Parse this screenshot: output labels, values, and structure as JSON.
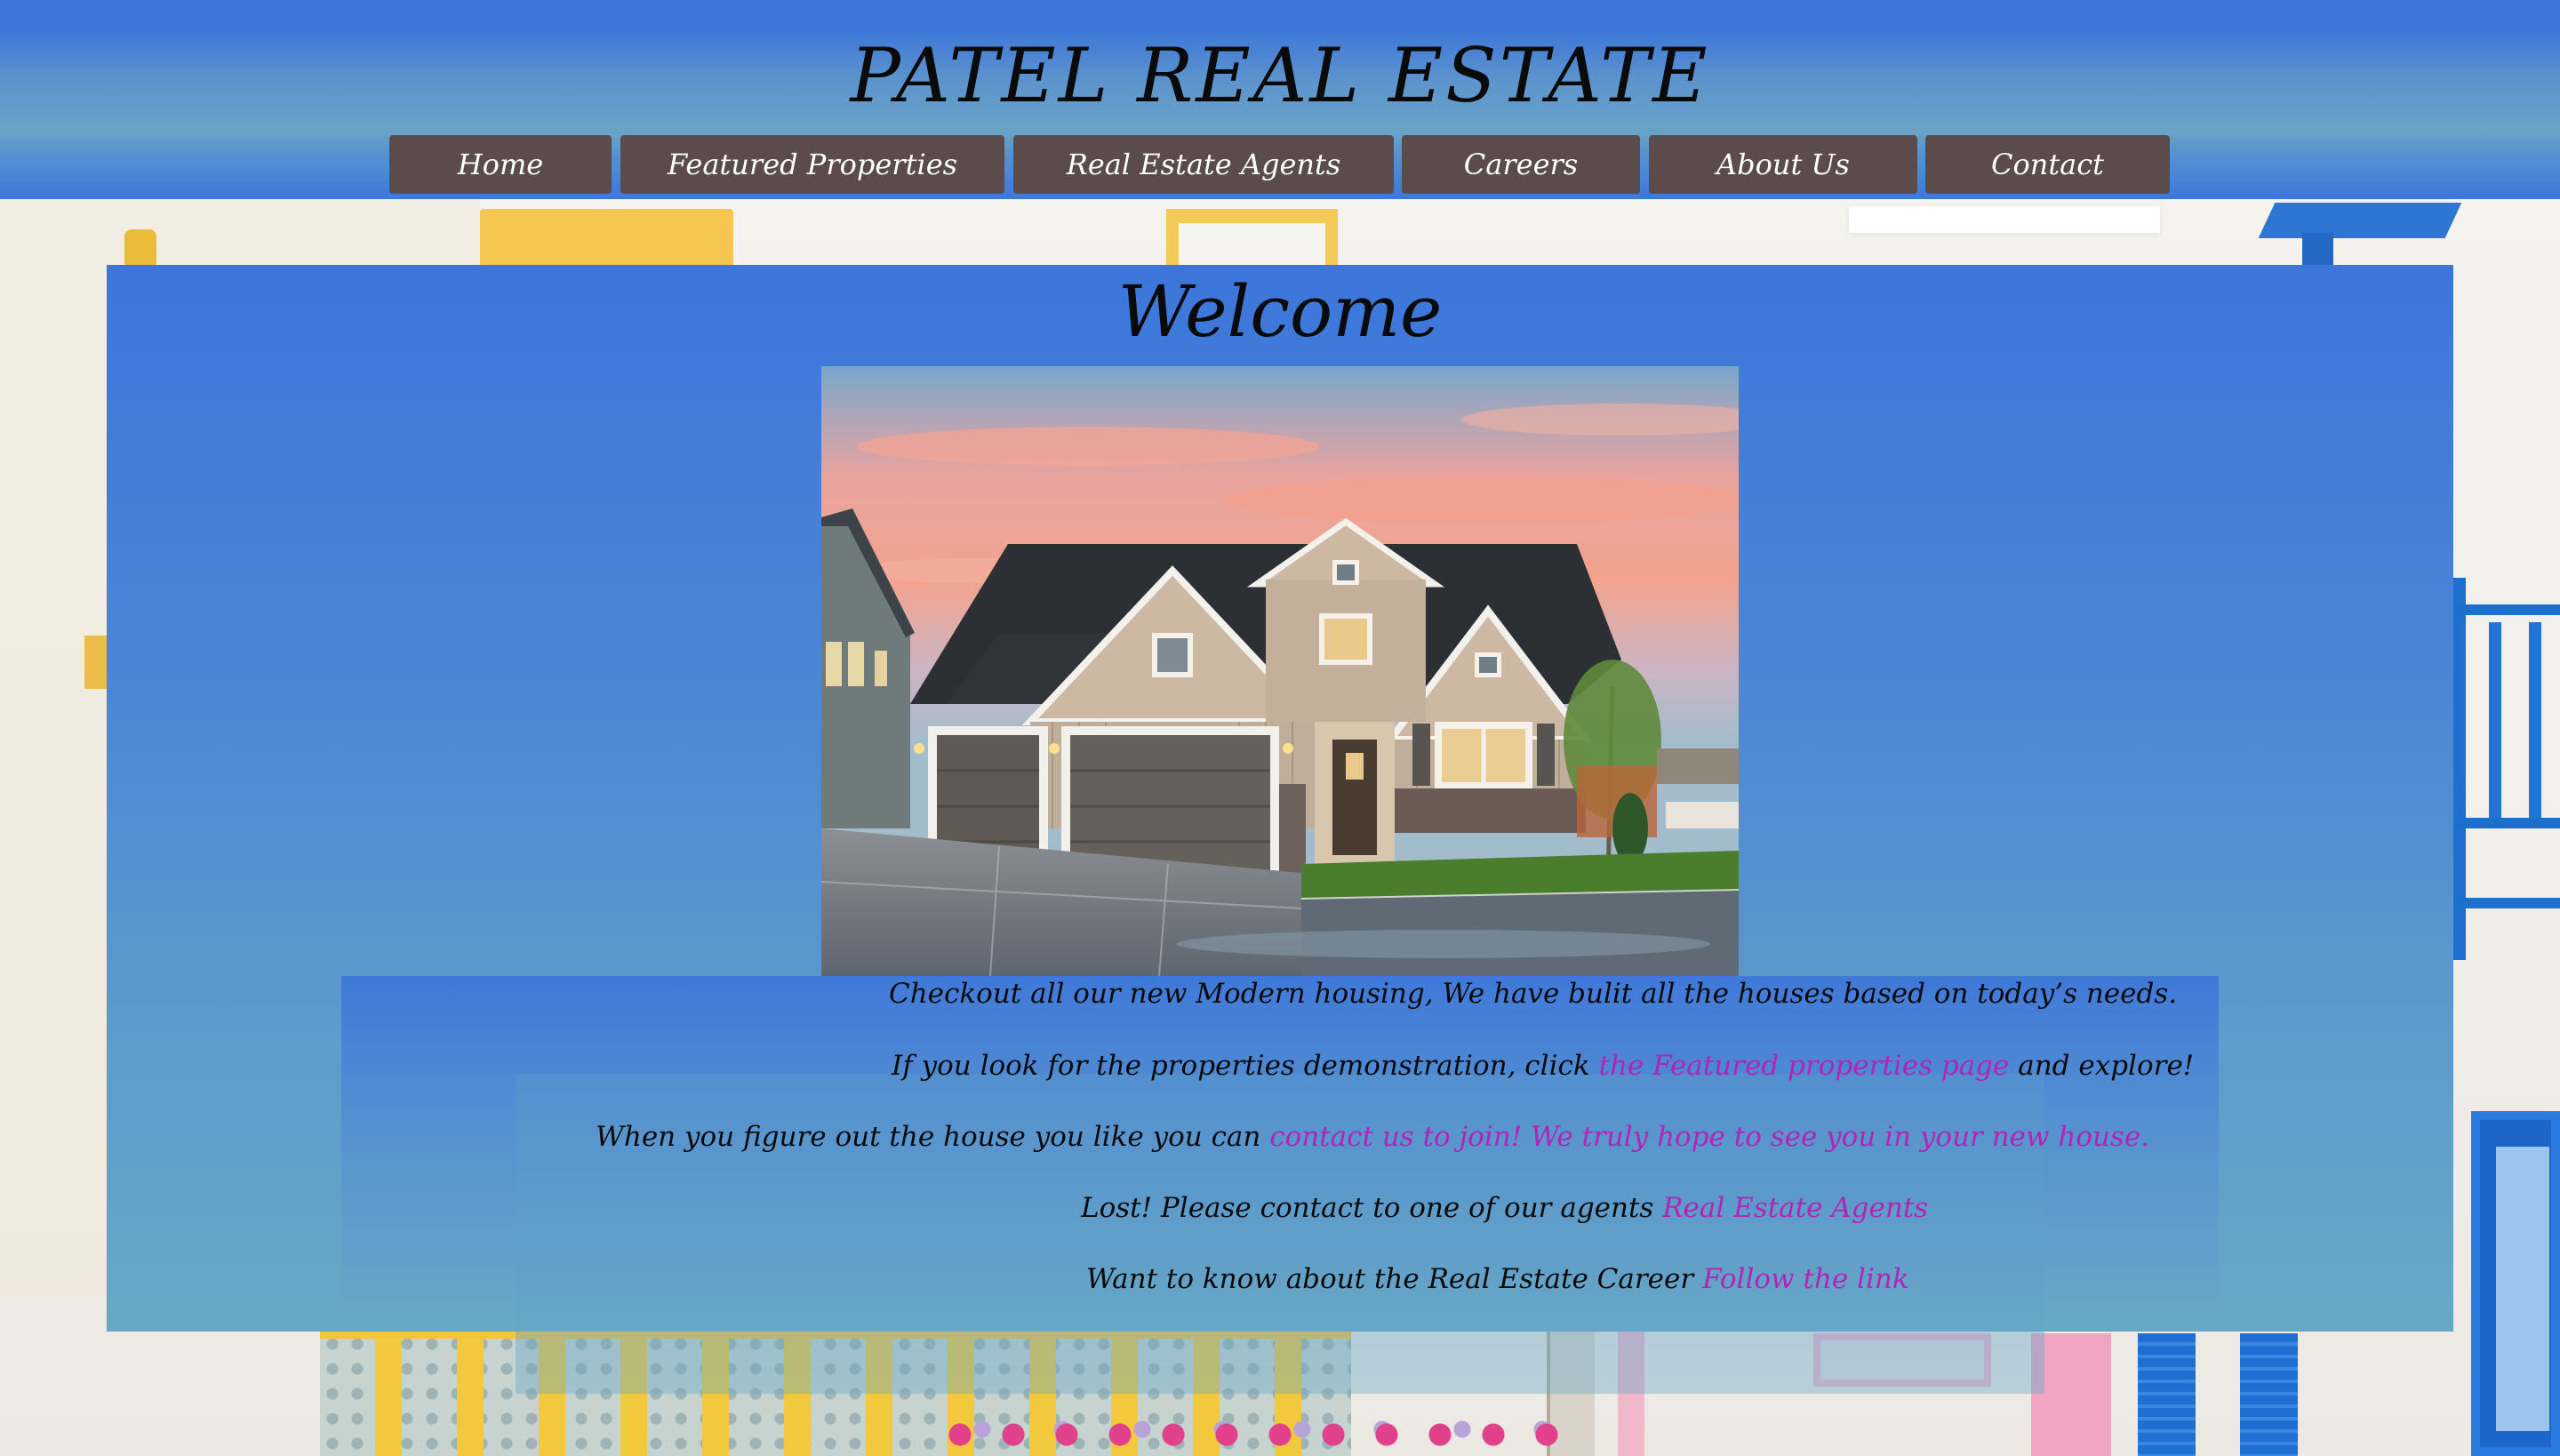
{
  "header": {
    "title": "PATEL REAL ESTATE"
  },
  "nav": {
    "items": [
      {
        "label": "Home"
      },
      {
        "label": "Featured Properties"
      },
      {
        "label": "Real Estate Agents"
      },
      {
        "label": "Careers"
      },
      {
        "label": "About Us"
      },
      {
        "label": "Contact"
      }
    ]
  },
  "main": {
    "heading": "Welcome",
    "paragraphs": [
      {
        "text": "Checkout all our new Modern housing, We have bulit all the houses based on today’s needs."
      },
      {
        "text": "If you look for the properties demonstration, click ",
        "link": "the Featured properties page",
        "after": " and explore!"
      },
      {
        "text": "When you figure out the house you like you can ",
        "link": "contact us to join! We truly hope to see you in your new house."
      },
      {
        "text": "Lost! Please contact to one of our agents ",
        "link": "Real Estate Agents"
      },
      {
        "text": "Want to know about the Real Estate Career ",
        "link": "Follow the link"
      }
    ]
  },
  "colors": {
    "header_blue": "#3b76d9",
    "nav_button": "#5b4b4b",
    "link": "#b323b5",
    "panel_blue": "#4d86d5"
  }
}
